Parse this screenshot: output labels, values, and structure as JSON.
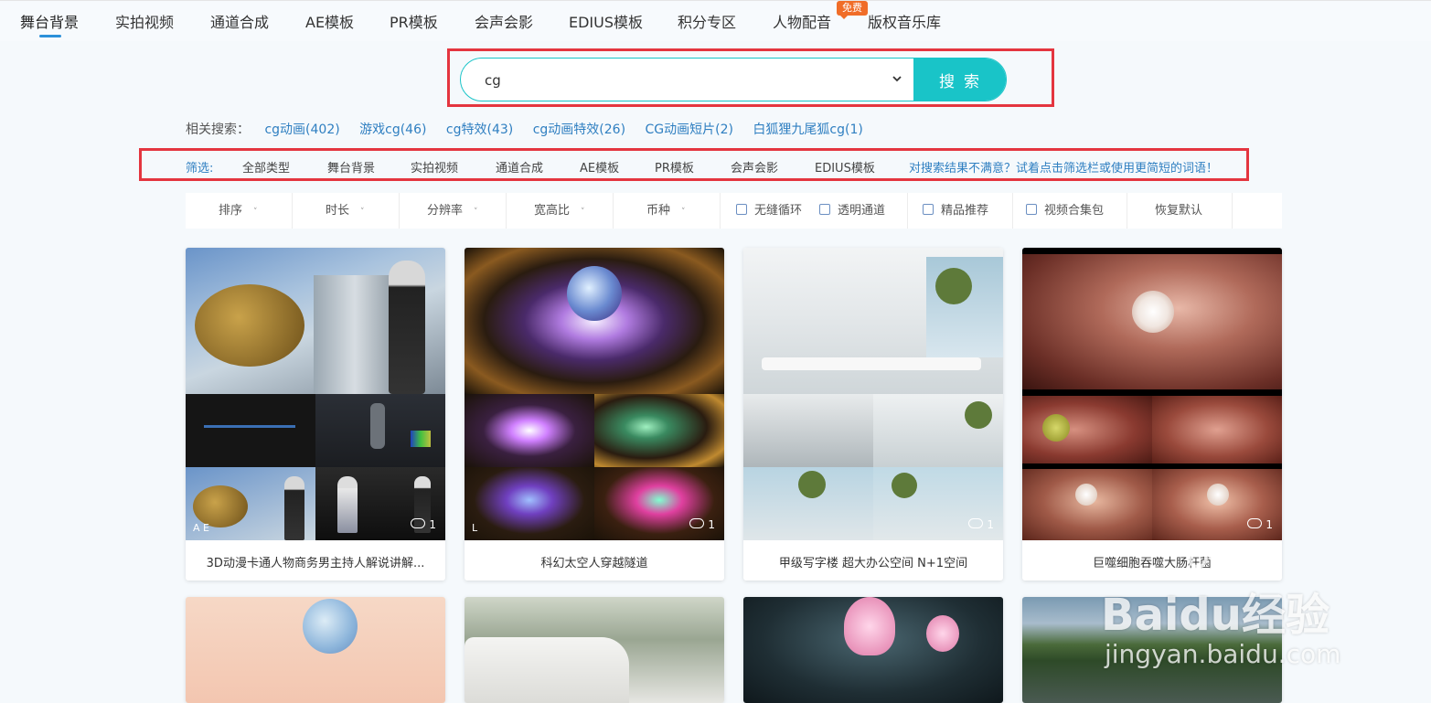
{
  "nav": {
    "items": [
      "舞台背景",
      "实拍视频",
      "通道合成",
      "AE模板",
      "PR模板",
      "会声会影",
      "EDIUS模板",
      "积分专区",
      "人物配音",
      "版权音乐库"
    ],
    "badge": "免费",
    "accent": "#2b90d9"
  },
  "search": {
    "value": "cg",
    "button": "搜索",
    "accent": "#19c4c8"
  },
  "related": {
    "label": "相关搜索：",
    "links": [
      "cg动画(402)",
      "游戏cg(46)",
      "cg特效(43)",
      "cg动画特效(26)",
      "CG动画短片(2)",
      "白狐狸九尾狐cg(1)"
    ]
  },
  "filter": {
    "label": "筛选:",
    "items": [
      "全部类型",
      "舞台背景",
      "实拍视频",
      "通道合成",
      "AE模板",
      "PR模板",
      "会声会影",
      "EDIUS模板"
    ],
    "tip": "对搜索结果不满意？试着点击筛选栏或使用更简短的词语！"
  },
  "options": {
    "dropdowns": [
      "排序",
      "时长",
      "分辨率",
      "宽高比",
      "币种"
    ],
    "checkboxes": [
      "无缝循环",
      "透明通道",
      "精品推荐",
      "视频合集包"
    ],
    "reset": "恢复默认"
  },
  "cards": [
    {
      "title": "3D动漫卡通人物商务男主持人解说讲解...",
      "downloads": "1",
      "corner": "A E"
    },
    {
      "title": "科幻太空人穿越隧道",
      "downloads": "1",
      "corner": "L"
    },
    {
      "title": "甲级写字楼 超大办公空间 N+1空间",
      "downloads": "1",
      "corner": ""
    },
    {
      "title": "巨噬细胞吞噬大肠杆菌",
      "downloads": "1",
      "corner": ""
    }
  ],
  "watermark": {
    "brand": "Baidu经验",
    "url": "jingyan.baidu.com"
  },
  "colors": {
    "highlight_border": "#e4353f",
    "link": "#2f7fc1",
    "badge": "#f06d28"
  }
}
